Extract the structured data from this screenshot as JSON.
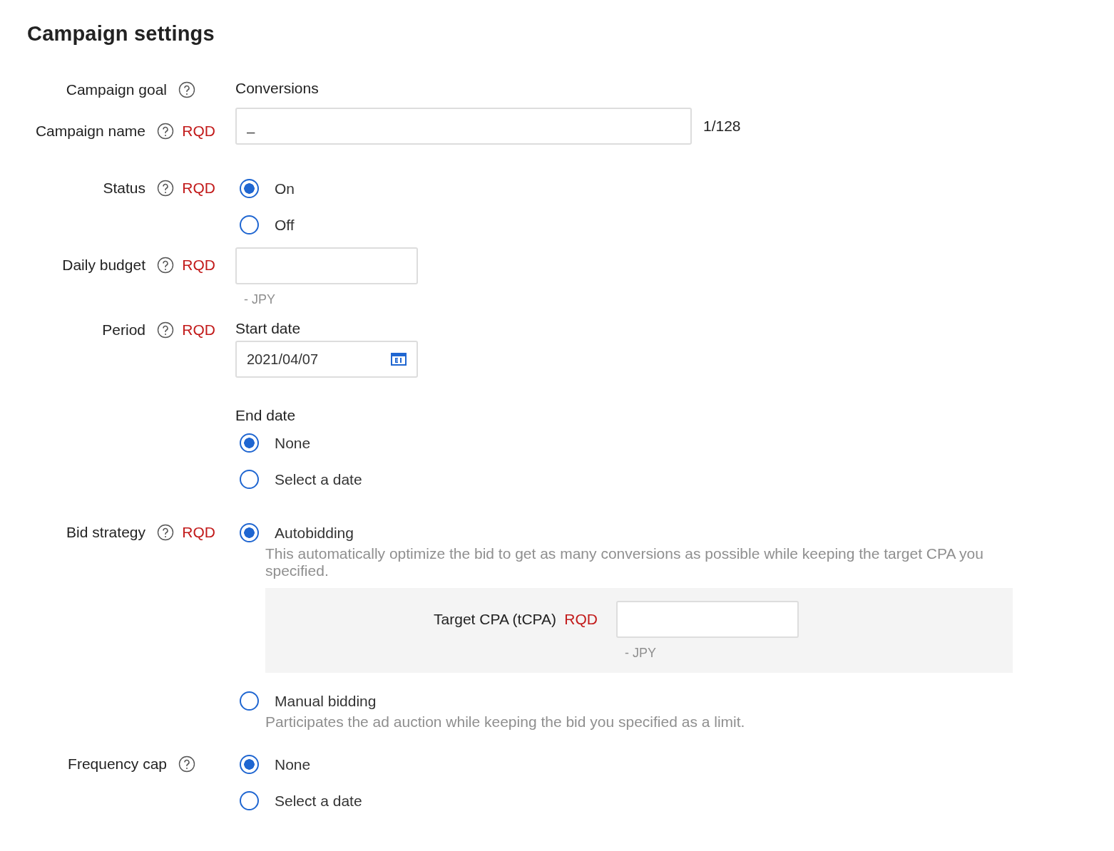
{
  "title": "Campaign settings",
  "fields": [
    {
      "kind": "static",
      "label": "Campaign goal",
      "value": "Conversions"
    },
    {
      "kind": "text",
      "label": "Campaign name",
      "required": "RQD",
      "value": "_",
      "counter": "1/128"
    },
    {
      "kind": "radio",
      "label": "Status",
      "required": "RQD",
      "options": [
        {
          "label": "On",
          "selected": true
        },
        {
          "label": "Off",
          "selected": false
        }
      ]
    },
    {
      "kind": "amount",
      "label": "Daily budget",
      "required": "RQD",
      "suffix": "- JPY"
    },
    {
      "kind": "period",
      "label": "Period",
      "required": "RQD",
      "start_label": "Start date",
      "start_value": "2021/04/07",
      "end_label": "End date",
      "options": [
        {
          "label": "None",
          "selected": true
        },
        {
          "label": "Select a date",
          "selected": false
        }
      ]
    },
    {
      "kind": "bid",
      "label": "Bid strategy",
      "required": "RQD",
      "options": [
        {
          "label": "Autobidding",
          "selected": true,
          "description": "This automatically optimize the bid to get as many conversions as possible while keeping the target CPA you specified.",
          "sub": {
            "label": "Target CPA (tCPA)",
            "required": "RQD",
            "suffix": "- JPY"
          }
        },
        {
          "label": "Manual bidding",
          "selected": false,
          "description": "Participates the ad auction while keeping the bid you specified as a limit."
        }
      ]
    },
    {
      "kind": "radio",
      "label": "Frequency cap",
      "options": [
        {
          "label": "None",
          "selected": true
        },
        {
          "label": "Select a date",
          "selected": false
        }
      ]
    }
  ]
}
